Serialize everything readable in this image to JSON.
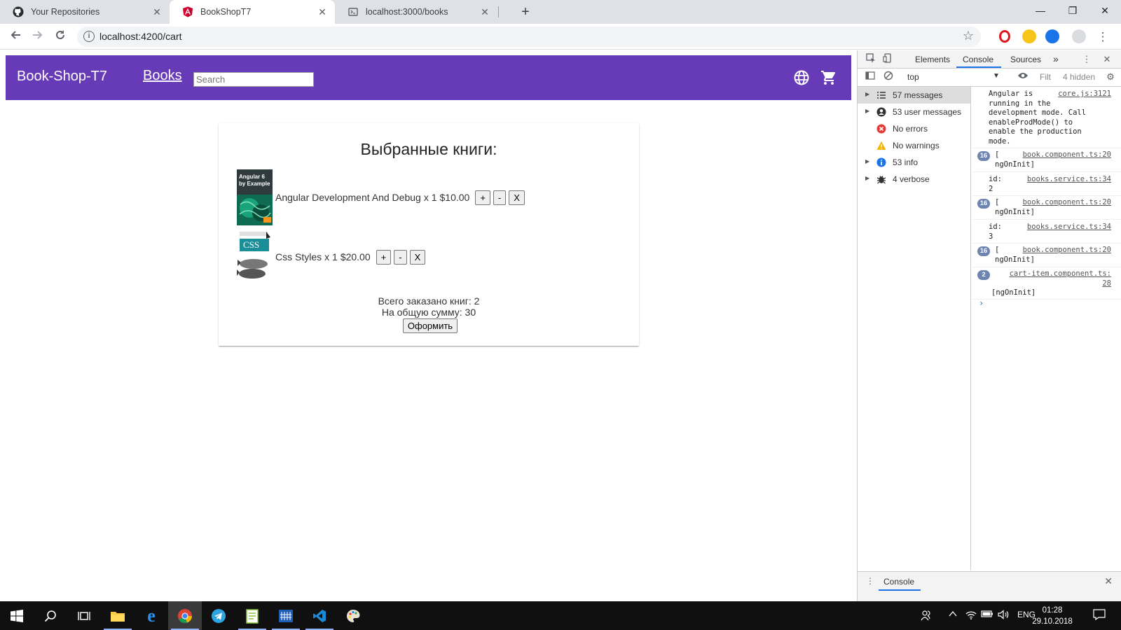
{
  "browser": {
    "tabs": [
      {
        "title": "Your Repositories",
        "icon": "github-icon"
      },
      {
        "title": "BookShopT7",
        "icon": "angular-icon"
      },
      {
        "title": "localhost:3000/books",
        "icon": "page-icon"
      }
    ],
    "active_tab": 1,
    "url": "localhost:4200/cart"
  },
  "app": {
    "brand": "Book-Shop-T7",
    "nav_books": "Books",
    "search_placeholder": "Search",
    "accent_color": "#673ab7",
    "icons": [
      "language-icon",
      "shopping-cart-icon"
    ]
  },
  "cart": {
    "title": "Выбранные книги:",
    "items": [
      {
        "name": "Angular Development And Debug",
        "qty": "x 1",
        "price": "$10.00",
        "cover_text": "Angular 6 by Example",
        "cover": "angular-book-cover"
      },
      {
        "name": "Css Styles",
        "qty": "x 1",
        "price": "$20.00",
        "cover_text": "CSS",
        "cover": "css-book-cover"
      }
    ],
    "buttons": {
      "plus": "+",
      "minus": "-",
      "remove": "X"
    },
    "total_count_line": "Всего заказано книг: 2",
    "total_sum_line": "На общую сумму: 30",
    "order_button": "Оформить"
  },
  "devtools": {
    "tabs": [
      "Elements",
      "Console",
      "Sources"
    ],
    "active_tab": "Console",
    "more": "»",
    "context": "top",
    "filter_placeholder": "Filt",
    "hidden": "4 hidden",
    "sidebar": [
      {
        "label": "57 messages",
        "icon": "list-icon",
        "selected": true
      },
      {
        "label": "53 user messages",
        "icon": "user-icon"
      },
      {
        "label": "No errors",
        "icon": "error-icon"
      },
      {
        "label": "No warnings",
        "icon": "warning-icon"
      },
      {
        "label": "53 info",
        "icon": "info-icon"
      },
      {
        "label": "4 verbose",
        "icon": "bug-icon"
      }
    ],
    "messages": [
      {
        "text": "Angular is\nrunning in the\ndevelopment mode. Call\nenableProdMode() to\nenable the production\nmode.",
        "source": "core.js:3121"
      },
      {
        "badge": "16",
        "text": "[\nngOnInit]",
        "source": "book.component.ts:20"
      },
      {
        "text": "id:\n2",
        "source": "books.service.ts:34"
      },
      {
        "badge": "16",
        "text": "[\nngOnInit]",
        "source": "book.component.ts:20"
      },
      {
        "text": "id:\n3",
        "source": "books.service.ts:34"
      },
      {
        "badge": "16",
        "text": "[\nngOnInit]",
        "source": "book.component.ts:20"
      },
      {
        "badge": "2",
        "text": "\n\n[ngOnInit]",
        "source": "cart-item.component.ts:\n28"
      }
    ],
    "prompt": "›",
    "drawer_tab": "Console"
  },
  "taskbar": {
    "language": "ENG",
    "time": "01:28",
    "date": "29.10.2018"
  }
}
